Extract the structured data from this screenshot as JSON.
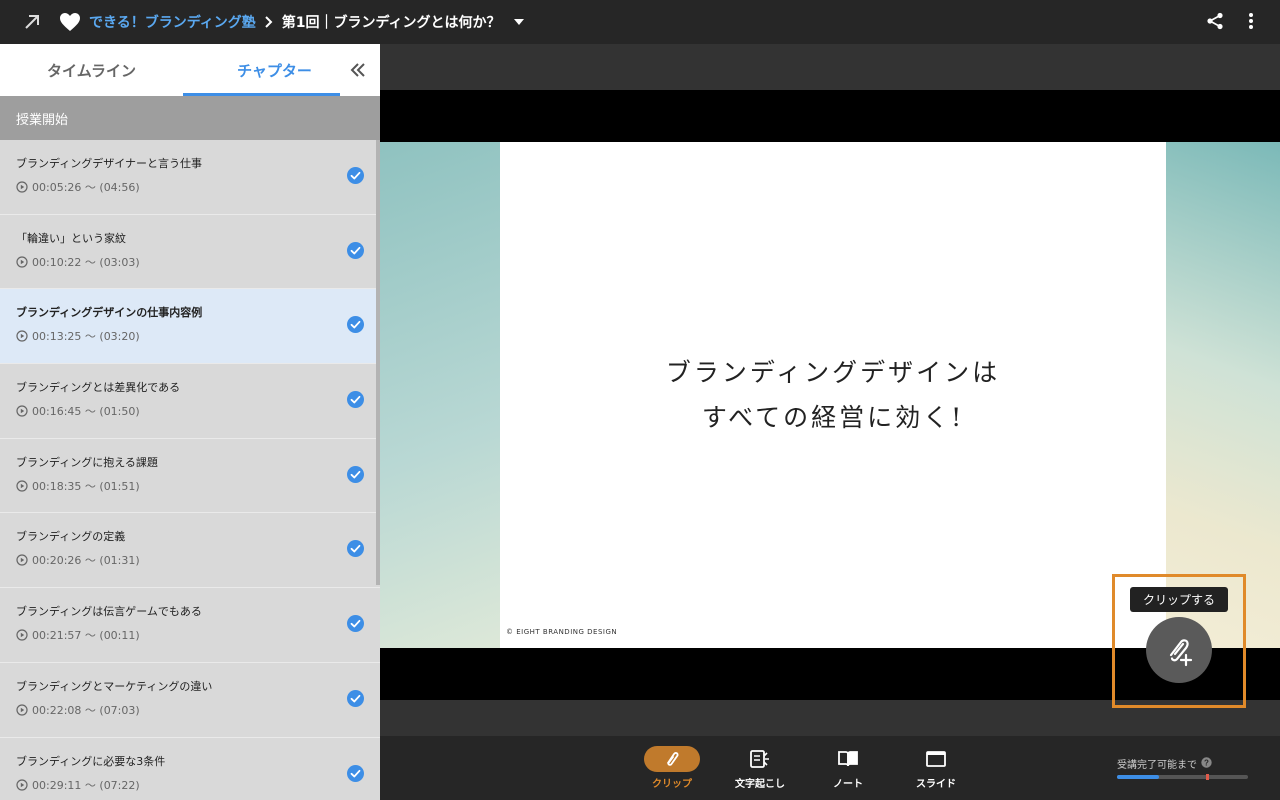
{
  "header": {
    "course": "できる！ブランディング塾",
    "lesson": "第1回｜ブランディングとは何か？"
  },
  "sidebar": {
    "tabs": [
      {
        "label": "タイムライン",
        "active": false
      },
      {
        "label": "チャプター",
        "active": true
      }
    ],
    "section": "授業開始",
    "chapters": [
      {
        "title": "ブランディングデザイナーと言う仕事",
        "time": "00:05:26 〜 (04:56)",
        "done": true,
        "active": false
      },
      {
        "title": "「輪違い」という家紋",
        "time": "00:10:22 〜 (03:03)",
        "done": true,
        "active": false
      },
      {
        "title": "ブランディングデザインの仕事内容例",
        "time": "00:13:25 〜 (03:20)",
        "done": true,
        "active": true
      },
      {
        "title": "ブランディングとは差異化である",
        "time": "00:16:45 〜 (01:50)",
        "done": true,
        "active": false
      },
      {
        "title": "ブランディングに抱える課題",
        "time": "00:18:35 〜 (01:51)",
        "done": true,
        "active": false
      },
      {
        "title": "ブランディングの定義",
        "time": "00:20:26 〜 (01:31)",
        "done": true,
        "active": false
      },
      {
        "title": "ブランディングは伝言ゲームでもある",
        "time": "00:21:57 〜 (00:11)",
        "done": true,
        "active": false
      },
      {
        "title": "ブランディングとマーケティングの違い",
        "time": "00:22:08 〜 (07:03)",
        "done": true,
        "active": false
      },
      {
        "title": "ブランディングに必要な3条件",
        "time": "00:29:11 〜 (07:22)",
        "done": true,
        "active": false
      }
    ]
  },
  "video": {
    "slide_line1": "ブランディングデザインは",
    "slide_line2": "すべての経営に効く!",
    "copyright": "© EIGHT BRANDING DESIGN",
    "clip_tooltip": "クリップする"
  },
  "toolbar": {
    "items": [
      {
        "label": "クリップ",
        "icon": "paperclip-icon",
        "active": true
      },
      {
        "label": "文字起こし",
        "icon": "transcript-icon",
        "active": false
      },
      {
        "label": "ノート",
        "icon": "notebook-icon",
        "active": false
      },
      {
        "label": "スライド",
        "icon": "slide-icon",
        "active": false
      }
    ],
    "progress_label": "受講完了可能まで",
    "progress_fraction": 0.32,
    "progress_marker_fraction": 0.68
  },
  "colors": {
    "accent": "#3d8ee6",
    "clip": "#e08a2a",
    "bar": "#262626"
  }
}
